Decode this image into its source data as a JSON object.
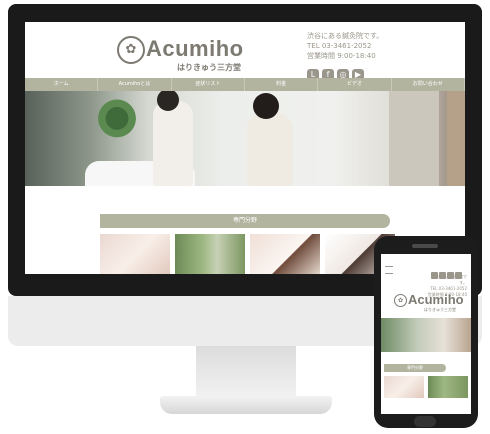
{
  "site": {
    "brand": "Acumiho",
    "subtitle": "はりきゅう三方堂",
    "info": [
      "渋谷にある鍼灸院です。",
      "TEL 03-3461-2052",
      "営業時間 9:00-18:40"
    ],
    "nav": [
      "ホーム",
      "Acumihoとは",
      "症状リスト",
      "料金",
      "ビデオ",
      "お問い合わせ"
    ],
    "section_title": "専門分野",
    "sns_icons": [
      "line-icon",
      "facebook-icon",
      "instagram-icon",
      "youtube-icon"
    ]
  },
  "mobile": {
    "brand": "Acumiho",
    "subtitle": "はりきゅう三方堂",
    "info": [
      "渋谷にある鍼灸院です。",
      "TEL 03-3461-2052",
      "営業時間 9:00-18:40"
    ],
    "section_title": "専門分野"
  },
  "colors": {
    "accent": "#b3b4a0",
    "text": "#7d7a72"
  }
}
